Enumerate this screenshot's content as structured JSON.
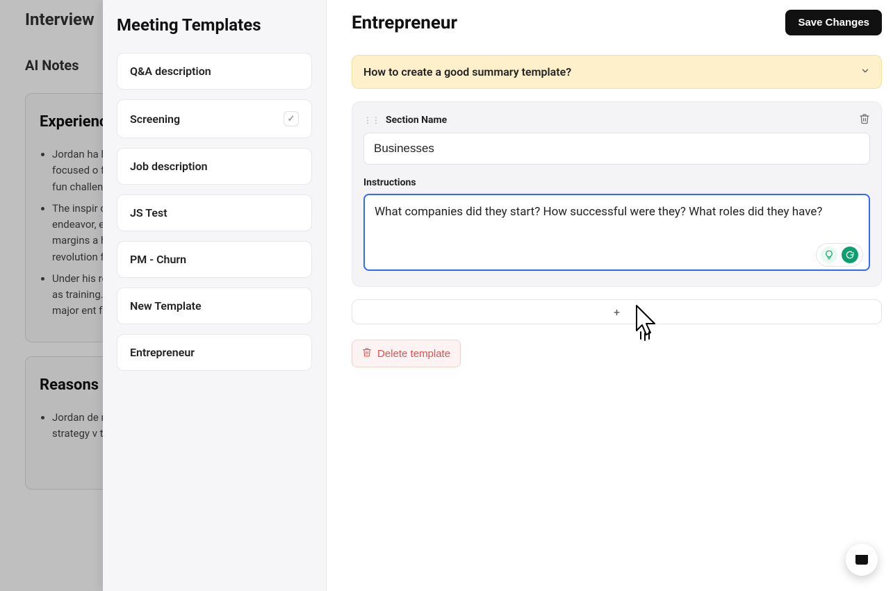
{
  "background": {
    "page_title": "Interview",
    "tab": "AI Notes",
    "card1_heading": "Experience",
    "bullets1": [
      "Jordan ha began his focused o for a brief hedge fun challengir founding",
      "The inspir drive inhe endeavor, eventually margins a hedge fun revolution for expert",
      "Under his revenue a various as training. H productiv major ent fostered c"
    ],
    "card2_heading": "Reasons f",
    "bullets2": [
      "Jordan de managem strategy v transform"
    ]
  },
  "drawer": {
    "heading": "Meeting Templates",
    "templates": [
      {
        "label": "Q&A description",
        "checked": false
      },
      {
        "label": "Screening",
        "checked": true
      },
      {
        "label": "Job description",
        "checked": false
      },
      {
        "label": "JS Test",
        "checked": false
      },
      {
        "label": "PM - Churn",
        "checked": false
      },
      {
        "label": "New Template",
        "checked": false
      },
      {
        "label": "Entrepreneur",
        "checked": false
      }
    ]
  },
  "main": {
    "title": "Entrepreneur",
    "save_button": "Save Changes",
    "tip_banner": "How to create a good summary template?",
    "section_name_label": "Section Name",
    "section_name_value": "Businesses",
    "instructions_label": "Instructions",
    "instructions_value": "What companies did they start? How successful were they? What roles did they have?",
    "add_section": "+",
    "delete_template": "Delete template"
  }
}
